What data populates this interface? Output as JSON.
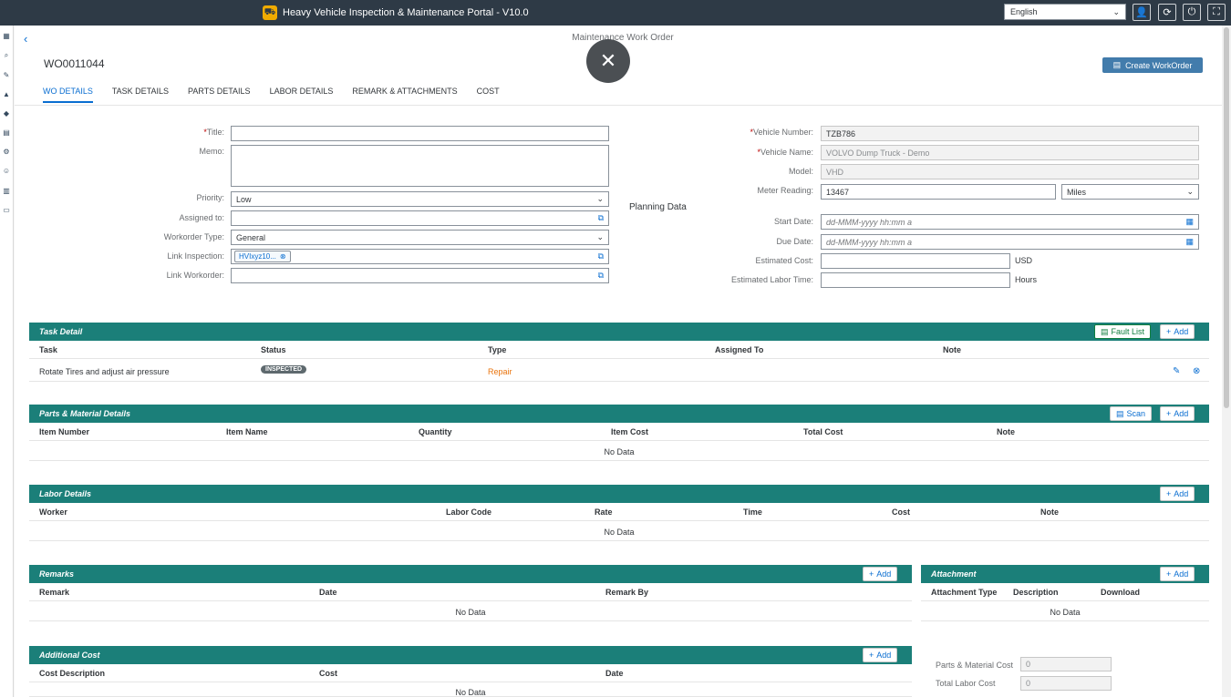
{
  "shell": {
    "title": "Heavy Vehicle Inspection & Maintenance Portal - V10.0",
    "language": "English"
  },
  "page": {
    "title": "Maintenance Work Order",
    "wo_number": "WO0011044",
    "create_button": "Create WorkOrder"
  },
  "tabs": [
    "WO DETAILS",
    "TASK DETAILS",
    "PARTS DETAILS",
    "LABOR DETAILS",
    "REMARK & ATTACHMENTS",
    "COST"
  ],
  "form_left": {
    "title_label": "Title:",
    "title_value": "",
    "memo_label": "Memo:",
    "priority_label": "Priority:",
    "priority_value": "Low",
    "assigned_label": "Assigned to:",
    "type_label": "Workorder Type:",
    "type_value": "General",
    "inspection_label": "Link Inspection:",
    "inspection_token": "HVIxyz10...",
    "workorder_label": "Link Workorder:"
  },
  "form_right": {
    "vehicle_number_label": "Vehicle Number:",
    "vehicle_number_value": "TZB786",
    "vehicle_name_label": "Vehicle Name:",
    "vehicle_name_value": "VOLVO Dump Truck - Demo",
    "model_label": "Model:",
    "model_value": "VHD",
    "meter_label": "Meter Reading:",
    "meter_value": "13467",
    "meter_unit": "Miles",
    "planning_title": "Planning Data",
    "start_label": "Start Date:",
    "due_label": "Due Date:",
    "date_placeholder": "dd-MMM-yyyy hh:mm a",
    "est_cost_label": "Estimated Cost:",
    "est_cost_unit": "USD",
    "est_labor_label": "Estimated Labor Time:",
    "est_labor_unit": "Hours"
  },
  "task_detail": {
    "title": "Task Detail",
    "fault_list": "Fault List",
    "add": "Add",
    "columns": [
      "Task",
      "Status",
      "Type",
      "Assigned To",
      "Note"
    ],
    "rows": [
      {
        "task": "Rotate Tires and adjust air pressure",
        "status": "INSPECTED",
        "type": "Repair",
        "assigned_to": "",
        "note": ""
      }
    ]
  },
  "parts": {
    "title": "Parts & Material Details",
    "scan": "Scan",
    "add": "Add",
    "columns": [
      "Item Number",
      "Item Name",
      "Quantity",
      "Item Cost",
      "Total Cost",
      "Note"
    ],
    "no_data": "No Data"
  },
  "labor": {
    "title": "Labor Details",
    "add": "Add",
    "columns": [
      "Worker",
      "Labor Code",
      "Rate",
      "Time",
      "Cost",
      "Note"
    ],
    "no_data": "No Data"
  },
  "remarks": {
    "title": "Remarks",
    "add": "Add",
    "columns": [
      "Remark",
      "Date",
      "Remark By"
    ],
    "no_data": "No Data"
  },
  "attachment": {
    "title": "Attachment",
    "add": "Add",
    "columns": [
      "Attachment Type",
      "Description",
      "Download"
    ],
    "no_data": "No Data"
  },
  "additional_cost": {
    "title": "Additional Cost",
    "add": "Add",
    "columns": [
      "Cost Description",
      "Cost",
      "Date"
    ],
    "no_data": "No Data"
  },
  "cost_summary": {
    "parts_label": "Parts & Material Cost",
    "parts_value": "0",
    "labor_label": "Total Labor Cost",
    "labor_value": "0"
  }
}
